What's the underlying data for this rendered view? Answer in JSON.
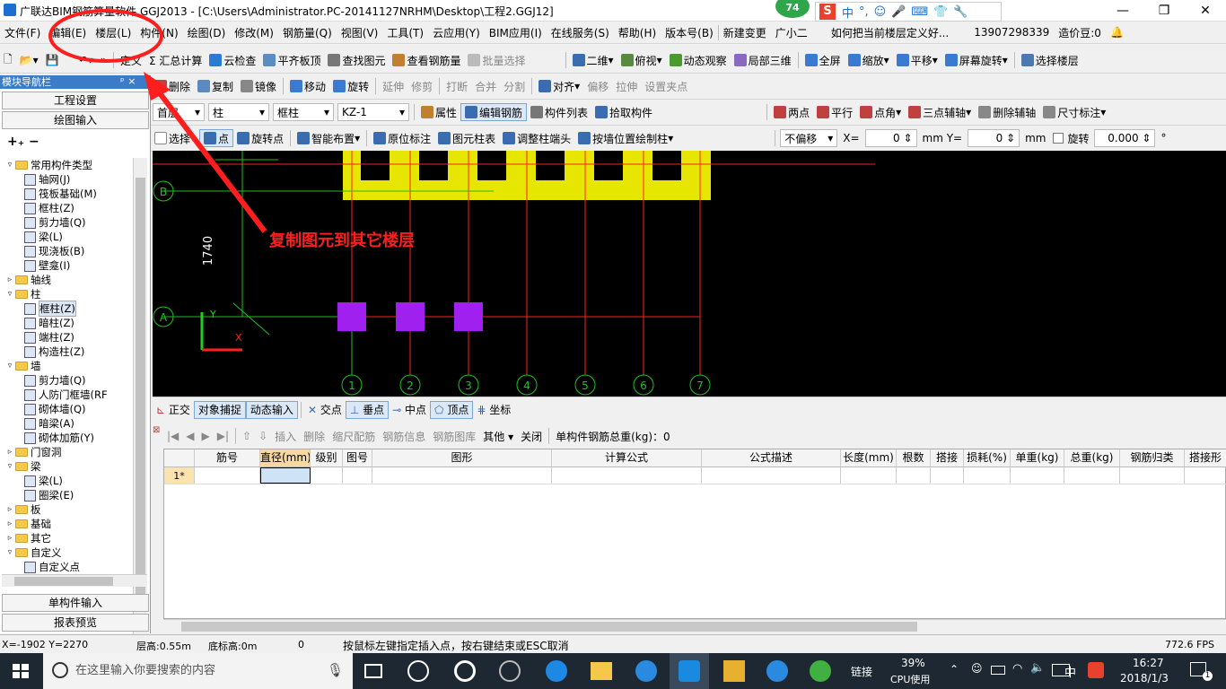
{
  "title": "广联达BIM钢筋算量软件 GGJ2013 - [C:\\Users\\Administrator.PC-20141127NRHM\\Desktop\\工程2.GGJ12]",
  "badge": "74",
  "ime": [
    "中",
    "°,",
    "☺",
    "🎤",
    "⌨",
    "👕",
    "🔧"
  ],
  "menu": [
    "文件(F)",
    "编辑(E)",
    "楼层(L)",
    "构件(N)",
    "绘图(D)",
    "修改(M)",
    "钢筋量(Q)",
    "视图(V)",
    "工具(T)",
    "云应用(Y)",
    "BIM应用(I)",
    "在线服务(S)",
    "帮助(H)",
    "版本号(B)",
    "新建变更",
    "广小二",
    "如何把当前楼层定义好...",
    "13907298339",
    "造价豆:0"
  ],
  "toolbar1": [
    "定义",
    "Σ 汇总计算",
    "云检查",
    "平齐板顶",
    "查找图元",
    "查看钢筋量",
    "批量选择",
    "二维",
    "俯视",
    "动态观察",
    "局部三维",
    "全屏",
    "缩放",
    "平移",
    "屏幕旋转",
    "选择楼层"
  ],
  "toolbar2": [
    "删除",
    "复制",
    "镜像",
    "移动",
    "旋转",
    "延伸",
    "修剪",
    "打断",
    "合并",
    "分割",
    "对齐",
    "偏移",
    "拉伸",
    "设置夹点"
  ],
  "toolbar3": {
    "floor": "首层",
    "type": "柱",
    "subtype": "框柱",
    "name": "KZ-1",
    "items": [
      "属性",
      "编辑钢筋",
      "构件列表",
      "拾取构件",
      "两点",
      "平行",
      "点角",
      "三点辅轴",
      "删除辅轴",
      "尺寸标注"
    ]
  },
  "toolbar4": {
    "items": [
      "选择",
      "点",
      "旋转点",
      "智能布置",
      "原位标注",
      "图元柱表",
      "调整柱端头",
      "按墙位置绘制柱"
    ],
    "offset": "不偏移",
    "x_label": "X=",
    "x_value": "0",
    "y_label": "mm Y=",
    "y_value": "0",
    "mm": "mm",
    "rotate": "旋转",
    "rotate_value": "0.000",
    "deg": "°"
  },
  "sidebar": {
    "title": "模块导航栏",
    "pin": "ᵖ ×",
    "btn1": "工程设置",
    "btn2": "绘图输入",
    "tree": [
      {
        "level": 0,
        "toggle": "▿",
        "folder": true,
        "label": "常用构件类型"
      },
      {
        "level": 1,
        "label": "轴网(J)"
      },
      {
        "level": 1,
        "label": "筏板基础(M)"
      },
      {
        "level": 1,
        "label": "框柱(Z)"
      },
      {
        "level": 1,
        "label": "剪力墙(Q)"
      },
      {
        "level": 1,
        "label": "梁(L)"
      },
      {
        "level": 1,
        "label": "现浇板(B)"
      },
      {
        "level": 1,
        "label": "壁龛(I)"
      },
      {
        "level": 0,
        "toggle": "▹",
        "folder": true,
        "label": "轴线"
      },
      {
        "level": 0,
        "toggle": "▿",
        "folder": true,
        "label": "柱"
      },
      {
        "level": 1,
        "label": "框柱(Z)"
      },
      {
        "level": 1,
        "label": "暗柱(Z)"
      },
      {
        "level": 1,
        "label": "端柱(Z)"
      },
      {
        "level": 1,
        "label": "构造柱(Z)"
      },
      {
        "level": 0,
        "toggle": "▿",
        "folder": true,
        "label": "墙"
      },
      {
        "level": 1,
        "label": "剪力墙(Q)"
      },
      {
        "level": 1,
        "label": "人防门框墙(RF"
      },
      {
        "level": 1,
        "label": "砌体墙(Q)"
      },
      {
        "level": 1,
        "label": "暗梁(A)"
      },
      {
        "level": 1,
        "label": "砌体加筋(Y)"
      },
      {
        "level": 0,
        "toggle": "▹",
        "folder": true,
        "label": "门窗洞"
      },
      {
        "level": 0,
        "toggle": "▿",
        "folder": true,
        "label": "梁"
      },
      {
        "level": 1,
        "label": "梁(L)"
      },
      {
        "level": 1,
        "label": "圈梁(E)"
      },
      {
        "level": 0,
        "toggle": "▹",
        "folder": true,
        "label": "板"
      },
      {
        "level": 0,
        "toggle": "▹",
        "folder": true,
        "label": "基础"
      },
      {
        "level": 0,
        "toggle": "▹",
        "folder": true,
        "label": "其它"
      },
      {
        "level": 0,
        "toggle": "▿",
        "folder": true,
        "label": "自定义"
      },
      {
        "level": 1,
        "label": "自定义点"
      }
    ],
    "btn3": "单构件输入",
    "btn4": "报表预览"
  },
  "canvas": {
    "dimension": "1740",
    "axis_rows": [
      "B",
      "A"
    ],
    "axis_cols": [
      "1",
      "2",
      "3",
      "4",
      "5",
      "6",
      "7"
    ],
    "y_axis": "Y",
    "x_axis": "X"
  },
  "annotation": "复制图元到其它楼层",
  "snapbar": [
    "正交",
    "对象捕捉",
    "动态输入",
    "交点",
    "垂点",
    "中点",
    "顶点",
    "坐标"
  ],
  "gridtoolbar": [
    "插入",
    "删除",
    "缩尺配筋",
    "钢筋信息",
    "钢筋图库",
    "其他",
    "关闭",
    "单构件钢筋总重(kg)：0"
  ],
  "grid": {
    "columns": [
      "",
      "筋号",
      "直径(mm)",
      "级别",
      "图号",
      "图形",
      "计算公式",
      "公式描述",
      "长度(mm)",
      "根数",
      "搭接",
      "损耗(%)",
      "单重(kg)",
      "总重(kg)",
      "钢筋归类",
      "搭接形"
    ],
    "row1": "1*"
  },
  "status": {
    "coords": "X=-1902 Y=2270",
    "floor_height": "层高:0.55m",
    "bottom_height": "底标高:0m",
    "zero": "0",
    "hint": "按鼠标左键指定插入点，按右键结束或ESC取消",
    "fps": "772.6 FPS"
  },
  "taskbar": {
    "search": "在这里输入你要搜索的内容",
    "link": "链接",
    "cpu": "39%",
    "cpu_label": "CPU使用",
    "ime": "中",
    "time": "16:27",
    "date": "2018/1/3",
    "notify": "1"
  }
}
